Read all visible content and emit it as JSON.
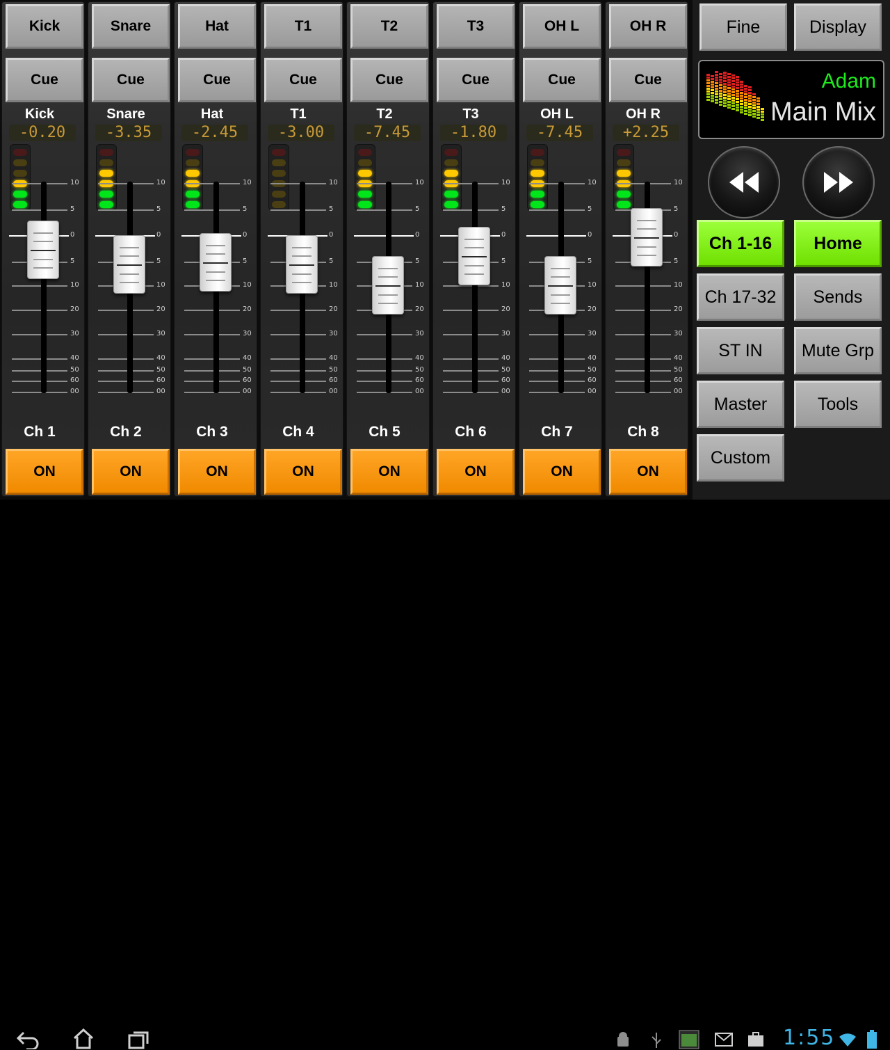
{
  "channels": [
    {
      "name": "Kick",
      "title": "Kick",
      "db": "-0.20",
      "label": "Ch 1",
      "cue": "Cue",
      "on": "ON",
      "meter": [
        false,
        false,
        false,
        true,
        true,
        true
      ],
      "level": 0.68
    },
    {
      "name": "Snare",
      "title": "Snare",
      "db": "-3.35",
      "label": "Ch 2",
      "cue": "Cue",
      "on": "ON",
      "meter": [
        false,
        false,
        true,
        true,
        true,
        true
      ],
      "level": 0.61
    },
    {
      "name": "Hat",
      "title": "Hat",
      "db": "-2.45",
      "label": "Ch 3",
      "cue": "Cue",
      "on": "ON",
      "meter": [
        false,
        false,
        true,
        true,
        true,
        true
      ],
      "level": 0.62
    },
    {
      "name": "T1",
      "title": "T1",
      "db": "-3.00",
      "label": "Ch 4",
      "cue": "Cue",
      "on": "ON",
      "meter": [
        false,
        false,
        false,
        false,
        false,
        false
      ],
      "level": 0.61
    },
    {
      "name": "T2",
      "title": "T2",
      "db": "-7.45",
      "label": "Ch 5",
      "cue": "Cue",
      "on": "ON",
      "meter": [
        false,
        false,
        true,
        true,
        true,
        true
      ],
      "level": 0.51
    },
    {
      "name": "T3",
      "title": "T3",
      "db": "-1.80",
      "label": "Ch 6",
      "cue": "Cue",
      "on": "ON",
      "meter": [
        false,
        false,
        true,
        true,
        true,
        true
      ],
      "level": 0.65
    },
    {
      "name": "OH L",
      "title": "OH L",
      "db": "-7.45",
      "label": "Ch 7",
      "cue": "Cue",
      "on": "ON",
      "meter": [
        false,
        false,
        true,
        true,
        true,
        true
      ],
      "level": 0.51
    },
    {
      "name": "OH R",
      "title": "OH R",
      "db": "+2.25",
      "label": "Ch 8",
      "cue": "Cue",
      "on": "ON",
      "meter": [
        false,
        false,
        true,
        true,
        true,
        true
      ],
      "level": 0.74
    }
  ],
  "scale": [
    "10",
    "5",
    "0",
    "5",
    "10",
    "20",
    "30",
    "40",
    "50",
    "60",
    "00"
  ],
  "right_panel": {
    "fine_label": "Fine",
    "display_label": "Display",
    "display_user": "Adam",
    "display_mix": "Main Mix",
    "buttons": [
      {
        "label": "Ch 1-16",
        "active": true
      },
      {
        "label": "Home",
        "active": true
      },
      {
        "label": "Ch 17-32",
        "active": false
      },
      {
        "label": "Sends",
        "active": false
      },
      {
        "label": "ST IN",
        "active": false
      },
      {
        "label": "Mute Grp",
        "active": false
      },
      {
        "label": "Master",
        "active": false
      },
      {
        "label": "Tools",
        "active": false
      },
      {
        "label": "Custom",
        "active": false
      }
    ]
  },
  "status_bar": {
    "clock": "1:55"
  },
  "colors": {
    "on_orange": "#ff9900",
    "active_green": "#7cf000",
    "user_green": "#1fea1f",
    "clock_blue": "#3fb6e6",
    "db_amber": "#c89a38"
  }
}
